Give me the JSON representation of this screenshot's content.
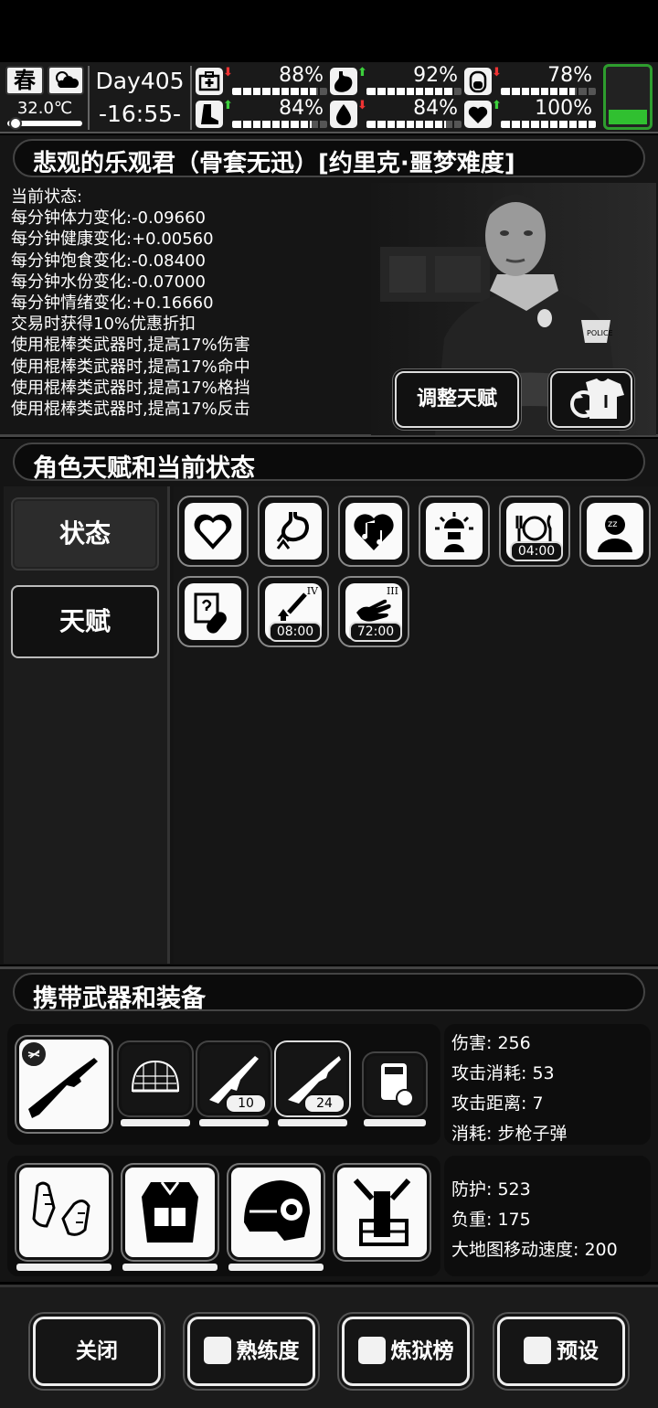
{
  "topbar": {
    "season": "春",
    "temperature": "32.0℃",
    "day": "Day405",
    "clock": "-16:55-",
    "stats": [
      {
        "icon": "medkit-icon",
        "trend": "down",
        "percent": "88%",
        "level": 0.88
      },
      {
        "icon": "stomach-icon",
        "trend": "up",
        "percent": "92%",
        "level": 0.92
      },
      {
        "icon": "bladder-icon",
        "trend": "down",
        "percent": "78%",
        "level": 0.78
      },
      {
        "icon": "boot-icon",
        "trend": "up",
        "percent": "84%",
        "level": 0.84
      },
      {
        "icon": "water-drop-icon",
        "trend": "down",
        "percent": "84%",
        "level": 0.84
      },
      {
        "icon": "heart-icon",
        "trend": "up",
        "percent": "100%",
        "level": 1.0
      }
    ],
    "arrows": {
      "up": "⬆",
      "down": "⬇"
    },
    "battery_level": 0.25
  },
  "character": {
    "title": "悲观的乐观君（骨套无迅）[约里克·噩梦难度]",
    "status_lines": [
      "当前状态:",
      "每分钟体力变化:-0.09660",
      "每分钟健康变化:+0.00560",
      "每分钟饱食变化:-0.08400",
      "每分钟水份变化:-0.07000",
      "每分钟情绪变化:+0.16660",
      "交易时获得10%优惠折扣",
      "使用棍棒类武器时,提高17%伤害",
      "使用棍棒类武器时,提高17%命中",
      "使用棍棒类武器时,提高17%格挡",
      "使用棍棒类武器时,提高17%反击"
    ],
    "badge_text": "POLICE",
    "adjust_talent_label": "调整天赋"
  },
  "talents": {
    "section_title": "角色天赋和当前状态",
    "tab_status": "状态",
    "tab_talent": "天赋",
    "icons": [
      {
        "name": "heart-status-icon",
        "timer": ""
      },
      {
        "name": "stomach-up-status-icon",
        "timer": ""
      },
      {
        "name": "music-heart-status-icon",
        "timer": ""
      },
      {
        "name": "alarm-person-status-icon",
        "timer": ""
      },
      {
        "name": "meal-status-icon",
        "timer": "04:00"
      },
      {
        "name": "sleep-status-icon",
        "timer": ""
      },
      {
        "name": "medicine-status-icon",
        "timer": ""
      },
      {
        "name": "syringe-boost-status-icon",
        "timer": "08:00",
        "roman": "IV"
      },
      {
        "name": "hand-status-icon",
        "timer": "72:00",
        "roman": "III"
      }
    ]
  },
  "equipment": {
    "section_title": "携带武器和装备",
    "ammo": [
      "10",
      "24"
    ],
    "weapon_stats": [
      "伤害: 256",
      "攻击消耗: 53",
      "攻击距离: 7",
      "消耗: 步枪子弹"
    ],
    "armor_stats": [
      "防护: 523",
      "负重: 175",
      "大地图移动速度: 200"
    ]
  },
  "bottom": {
    "close": "关闭",
    "proficiency": "熟练度",
    "ranking": "炼狱榜",
    "preset": "预设"
  }
}
